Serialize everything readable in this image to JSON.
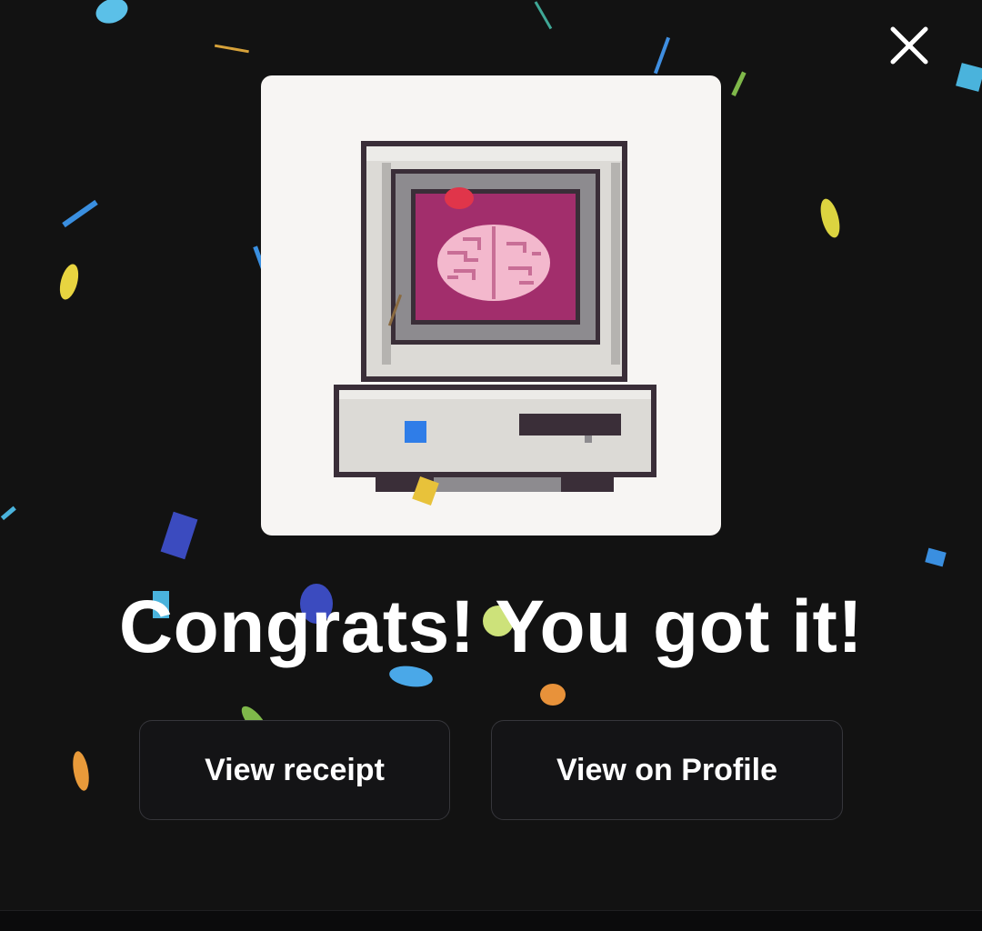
{
  "modal": {
    "title": "Congrats! You got it!",
    "close_icon": "close-icon",
    "artwork_icon": "retro-computer-brain-icon"
  },
  "actions": {
    "view_receipt_label": "View receipt",
    "view_profile_label": "View on Profile"
  },
  "colors": {
    "background": "#121212",
    "card": "#f7f5f3",
    "screen": "#a22e6c",
    "brain": "#f3b8cd",
    "button_border": "#36363b",
    "text": "#ffffff"
  }
}
